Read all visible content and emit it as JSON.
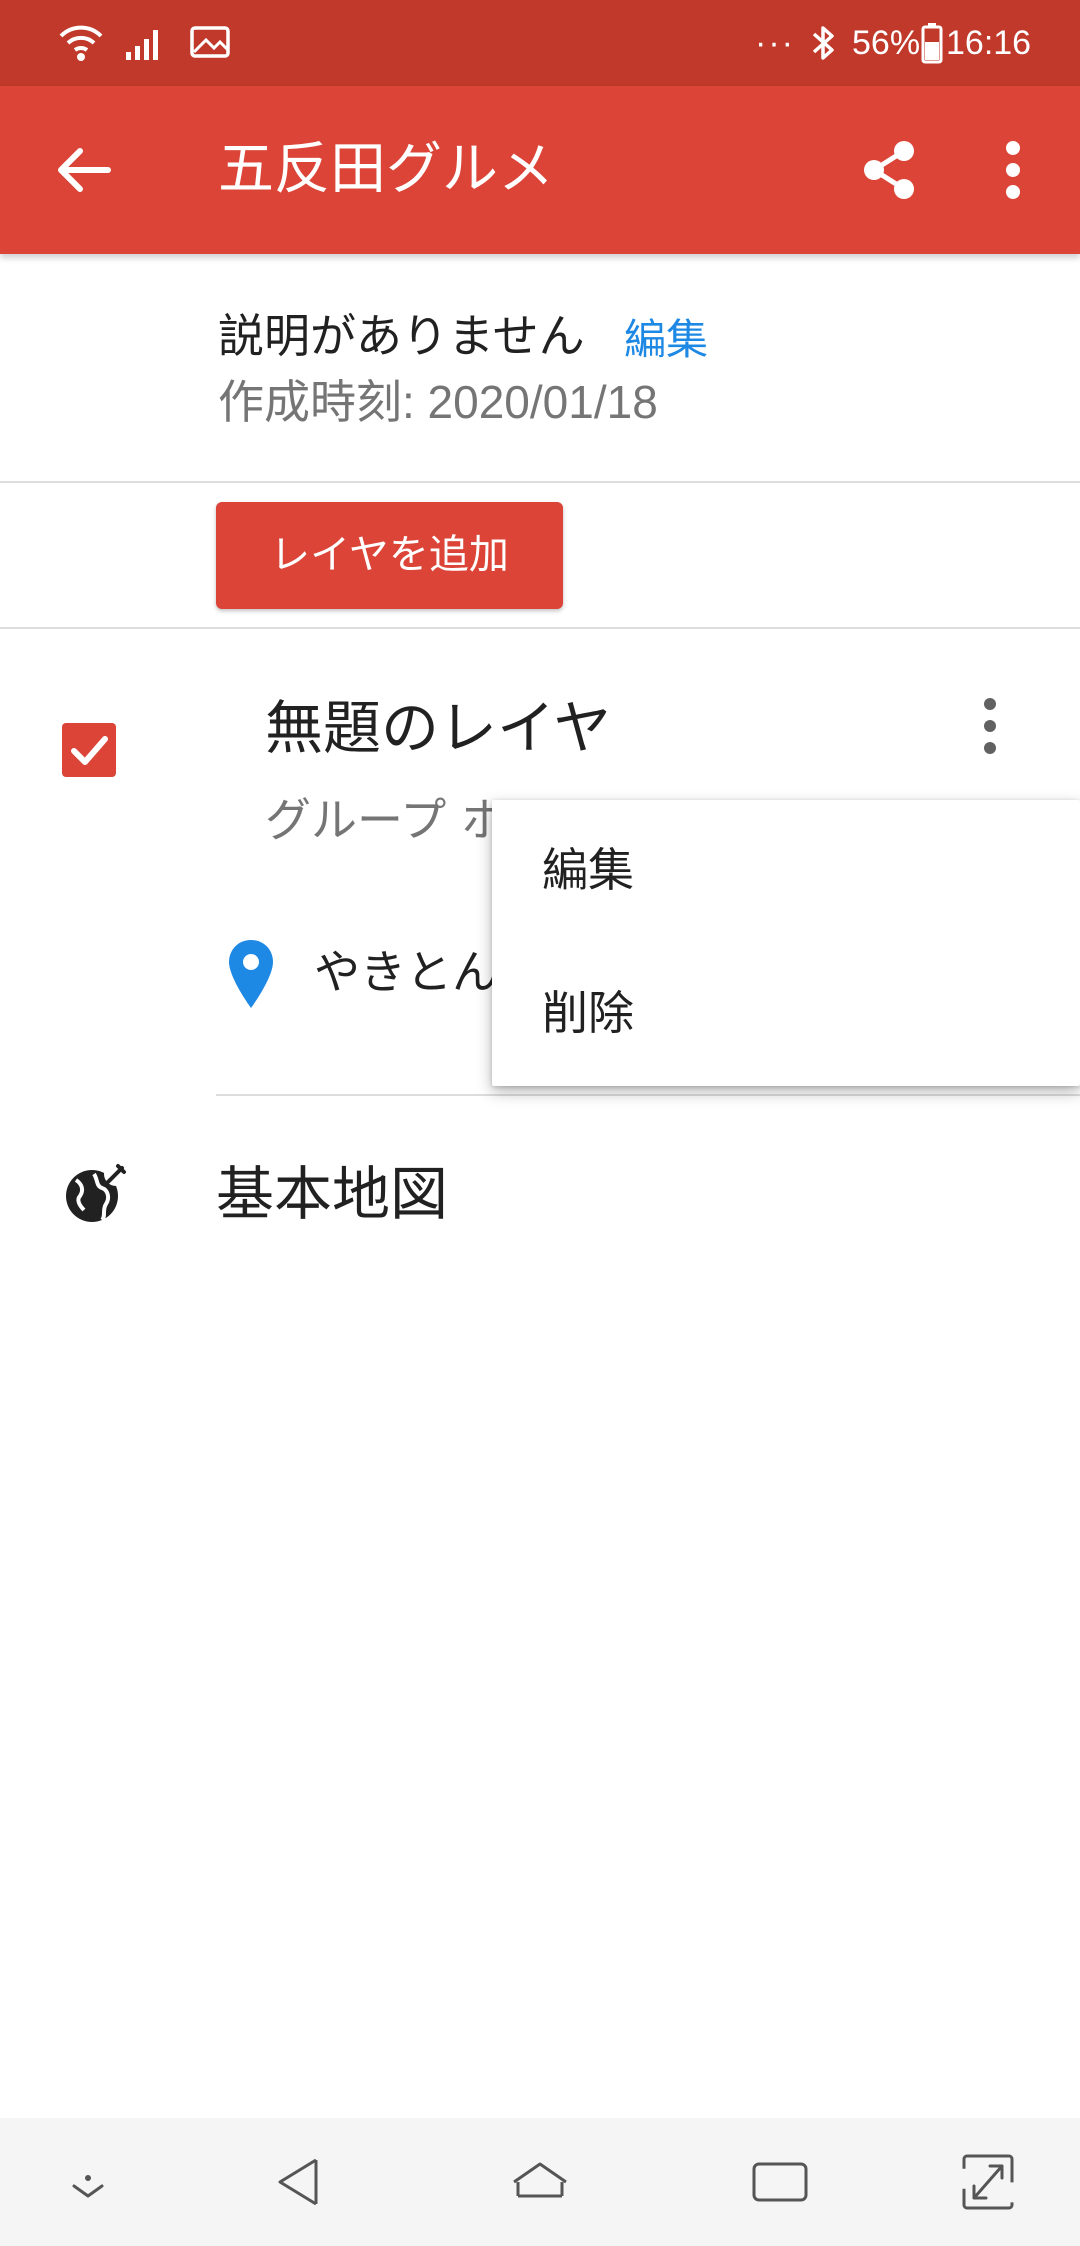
{
  "status_bar": {
    "icons": [
      "wifi-icon",
      "signal-icon",
      "image-icon",
      "more-dots-icon",
      "bluetooth-icon",
      "battery-icon"
    ],
    "dots": "···",
    "battery": "56%",
    "time": "16:16"
  },
  "app_bar": {
    "title": "五反田グルメ",
    "icons": [
      "back-arrow-icon",
      "share-icon",
      "more-vert-icon"
    ],
    "color": "#db4437"
  },
  "map_info": {
    "description": "説明がありません",
    "edit_link": "編集",
    "created": "作成時刻: 2020/01/18"
  },
  "add_layer_button": "レイヤを追加",
  "layer": {
    "checked": true,
    "title": "無題のレイヤ",
    "group": "グループ ホ",
    "place": "やきとん"
  },
  "basemap": {
    "label": "基本地図",
    "icon": "globe-edit-icon"
  },
  "popup_menu": {
    "items": [
      {
        "label": "編集"
      },
      {
        "label": "削除"
      }
    ]
  },
  "nav_bar": {
    "icons": [
      "hide-keyboard-icon",
      "back-triangle-icon",
      "home-icon",
      "recents-icon",
      "fullscreen-icon"
    ]
  },
  "colors": {
    "status_bar": "#c0392b",
    "primary": "#db4437",
    "link": "#1e88e5",
    "pin": "#1e88e5"
  }
}
